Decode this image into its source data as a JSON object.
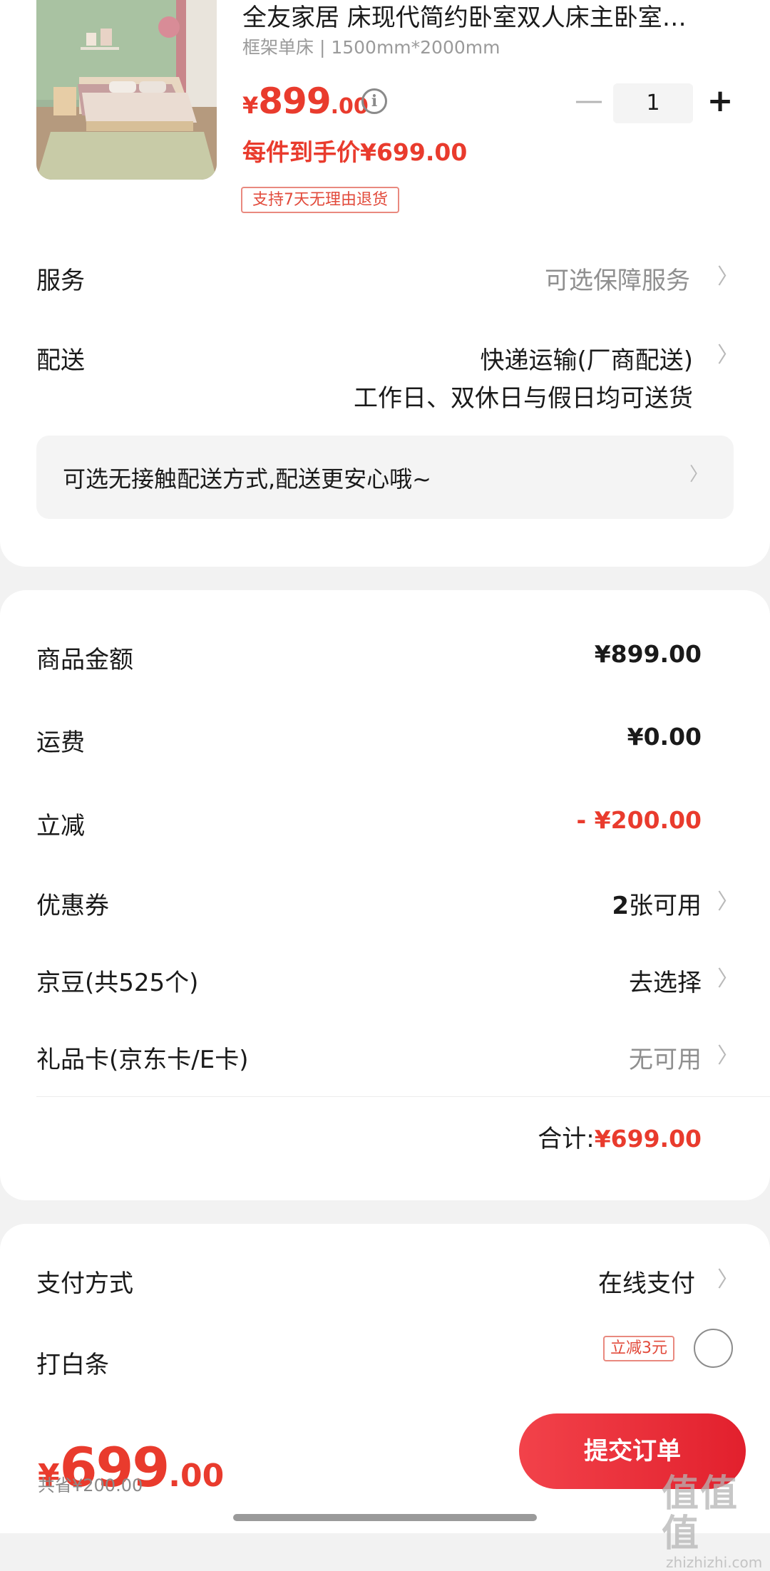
{
  "product": {
    "title": "全友家居 床现代简约卧室双人床主卧室…",
    "spec": "框架单床 | 1500mm*2000mm",
    "price_symbol": "¥",
    "price_int": "899",
    "price_dec": ".00",
    "quantity": "1",
    "final_price": "每件到手价¥699.00",
    "return_badge": "支持7天无理由退货"
  },
  "service": {
    "label": "服务",
    "value": "可选保障服务"
  },
  "delivery": {
    "label": "配送",
    "method": "快递运输(厂商配送)",
    "note": "工作日、双休日与假日均可送货",
    "contactless": "可选无接触配送方式,配送更安心哦~"
  },
  "summary": {
    "goods_amount_label": "商品金额",
    "goods_amount_value": "¥899.00",
    "shipping_label": "运费",
    "shipping_value": "¥0.00",
    "discount_label": "立减",
    "discount_value": "- ¥200.00",
    "coupon_label": "优惠券",
    "coupon_count": "2",
    "coupon_suffix": "张可用",
    "jingdou_label": "京豆(共525个)",
    "jingdou_value": "去选择",
    "giftcard_label": "礼品卡(京东卡/E卡)",
    "giftcard_value": "无可用",
    "total_label": "合计:",
    "total_value": "¥699.00"
  },
  "payment": {
    "method_label": "支付方式",
    "method_value": "在线支付",
    "baitiao_label": "打白条",
    "baitiao_badge": "立减3元"
  },
  "bottom": {
    "price_symbol": "¥",
    "price_int": "699",
    "price_dec": ".00",
    "saved": "共省¥200.00",
    "submit": "提交订单"
  },
  "watermark": {
    "main": "值值值",
    "sub": "zhizhizhi.com"
  },
  "colors": {
    "accent": "#e93b2d",
    "background": "#f2f2f2"
  }
}
